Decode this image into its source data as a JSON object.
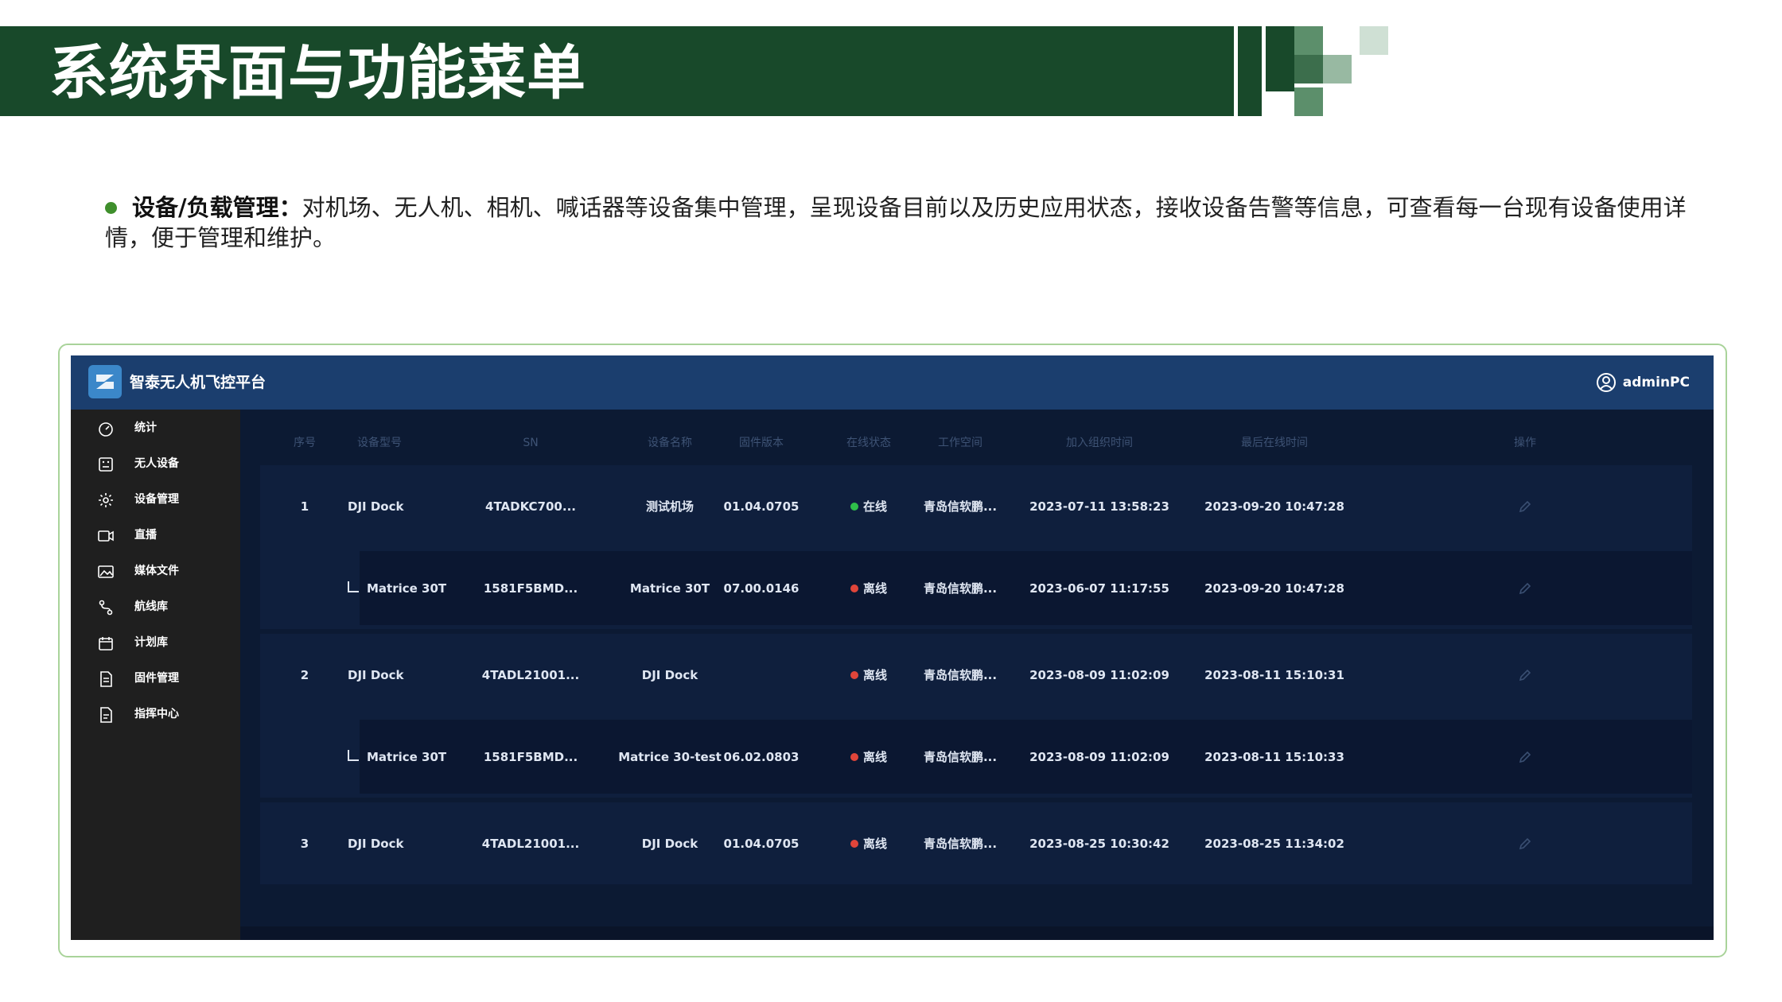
{
  "slide": {
    "title": "系统界面与功能菜单",
    "bullet_lead": "设备/负载管理：",
    "bullet_text": "对机场、无人机、相机、喊话器等设备集中管理，呈现设备目前以及历史应用状态，接收设备告警等信息，可查看每一台现有设备使用详情，便于管理和维护。",
    "accent_color": "#18492a"
  },
  "app": {
    "title": "智泰无人机飞控平台",
    "user": "adminPC",
    "header_color": "#1b3e6e"
  },
  "sidebar": {
    "items": [
      {
        "label": "统计",
        "icon": "dashboard-icon"
      },
      {
        "label": "无人设备",
        "icon": "device-icon"
      },
      {
        "label": "设备管理",
        "icon": "gear-icon"
      },
      {
        "label": "直播",
        "icon": "video-camera-icon"
      },
      {
        "label": "媒体文件",
        "icon": "image-icon"
      },
      {
        "label": "航线库",
        "icon": "route-icon"
      },
      {
        "label": "计划库",
        "icon": "calendar-icon"
      },
      {
        "label": "固件管理",
        "icon": "file-icon"
      },
      {
        "label": "指挥中心",
        "icon": "document-icon"
      }
    ]
  },
  "table": {
    "headers": [
      "序号",
      "设备型号",
      "SN",
      "设备名称",
      "固件版本",
      "在线状态",
      "工作空间",
      "加入组织时间",
      "最后在线时间",
      "操作"
    ],
    "groups": [
      {
        "index": "1",
        "rows": [
          {
            "model": "DJI Dock",
            "sn": "4TADKC700...",
            "name": "测试机场",
            "firmware": "01.04.0705",
            "status": "在线",
            "status_color": "#2fbf4a",
            "workspace": "青岛信软鹏...",
            "joined": "2023-07-11 13:58:23",
            "last_online": "2023-09-20 10:47:28"
          },
          {
            "model": "Matrice 30T",
            "sn": "1581F5BMD...",
            "name": "Matrice 30T",
            "firmware": "07.00.0146",
            "status": "离线",
            "status_color": "#e0453a",
            "workspace": "青岛信软鹏...",
            "joined": "2023-06-07 11:17:55",
            "last_online": "2023-09-20 10:47:28"
          }
        ]
      },
      {
        "index": "2",
        "rows": [
          {
            "model": "DJI Dock",
            "sn": "4TADL21001...",
            "name": "DJI Dock",
            "firmware": "",
            "status": "离线",
            "status_color": "#e0453a",
            "workspace": "青岛信软鹏...",
            "joined": "2023-08-09 11:02:09",
            "last_online": "2023-08-11 15:10:31"
          },
          {
            "model": "Matrice 30T",
            "sn": "1581F5BMD...",
            "name": "Matrice 30-test",
            "firmware": "06.02.0803",
            "status": "离线",
            "status_color": "#e0453a",
            "workspace": "青岛信软鹏...",
            "joined": "2023-08-09 11:02:09",
            "last_online": "2023-08-11 15:10:33"
          }
        ]
      },
      {
        "index": "3",
        "rows": [
          {
            "model": "DJI Dock",
            "sn": "4TADL21001...",
            "name": "DJI Dock",
            "firmware": "01.04.0705",
            "status": "离线",
            "status_color": "#e0453a",
            "workspace": "青岛信软鹏...",
            "joined": "2023-08-25 10:30:42",
            "last_online": "2023-08-25 11:34:02"
          }
        ]
      }
    ]
  }
}
